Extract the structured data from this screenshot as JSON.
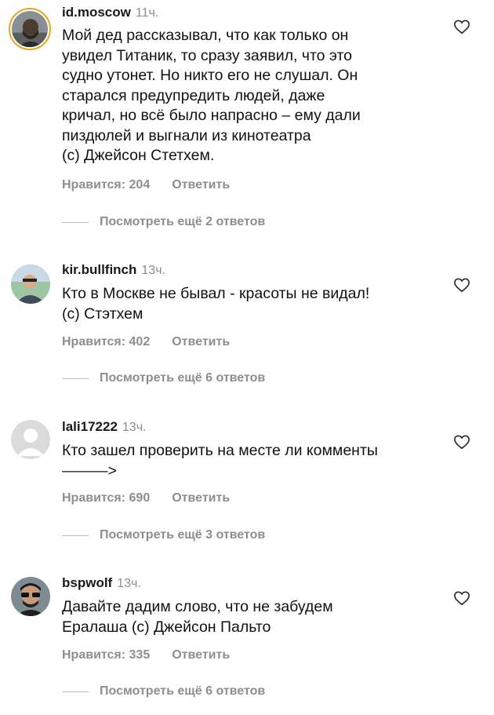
{
  "comments": [
    {
      "username": "id.moscow",
      "time": "11ч.",
      "text": "Мой дед рассказывал, что как только он\nувидел Титаник, то сразу заявил, что это\nсудно утонет. Но никто его не слушал. Он\nстарался предупредить людей, даже\nкричал, но всё было напрасно – ему дали\nпиздюлей и выгнали из кинотеатра\n(с) Джейсон Стетхем.",
      "likes": "Нравится: 204",
      "reply": "Ответить",
      "view_replies": "Посмотреть ещё 2 ответов",
      "avatar": "person-with-beard-photo"
    },
    {
      "username": "kir.bullfinch",
      "time": "13ч.",
      "text": "Кто в Москве не бывал - красоты не видал!\n(с) Стэтхем",
      "likes": "Нравится: 402",
      "reply": "Ответить",
      "view_replies": "Посмотреть ещё 6 ответов",
      "avatar": "person-with-glasses-photo"
    },
    {
      "username": "lali17222",
      "time": "13ч.",
      "text": "Кто зашел проверить на месте ли комменты\n———>",
      "likes": "Нравится: 690",
      "reply": "Ответить",
      "view_replies": "Посмотреть ещё 3 ответов",
      "avatar": "default-avatar"
    },
    {
      "username": "bspwolf",
      "time": "13ч.",
      "text": "Давайте дадим слово, что не забудем\nЕралаша (с) Джейсон Пальто",
      "likes": "Нравится: 335",
      "reply": "Ответить",
      "view_replies": "Посмотреть ещё 6 ответов",
      "avatar": "person-in-sunglasses-photo"
    }
  ],
  "icons": {
    "like": "heart-outline-icon"
  },
  "colors": {
    "story_ring": "#e4a71b",
    "secondary_text": "#8e8e8e"
  }
}
